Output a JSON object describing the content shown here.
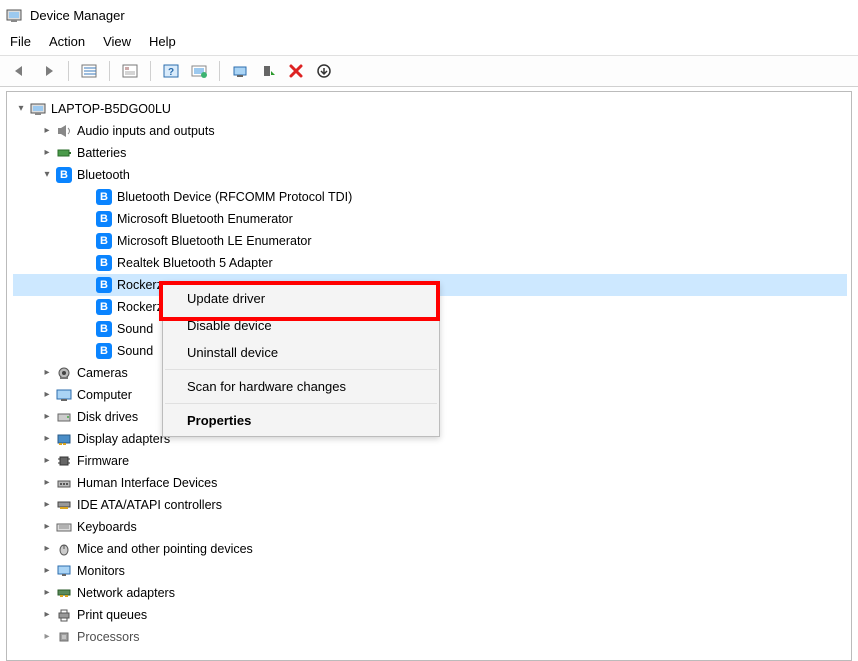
{
  "window": {
    "title": "Device Manager"
  },
  "menubar": {
    "items": [
      "File",
      "Action",
      "View",
      "Help"
    ]
  },
  "toolbar": {
    "buttons": [
      "back",
      "forward",
      "show-hidden",
      "help-topics",
      "help",
      "scan-hardware",
      "enable",
      "disable",
      "uninstall",
      "update-driver"
    ]
  },
  "tree": {
    "root": "LAPTOP-B5DGO0LU",
    "nodes": [
      {
        "label": "Audio inputs and outputs",
        "icon": "speaker",
        "expanded": false
      },
      {
        "label": "Batteries",
        "icon": "battery",
        "expanded": false
      },
      {
        "label": "Bluetooth",
        "icon": "bluetooth",
        "expanded": true,
        "children": [
          {
            "label": "Bluetooth Device (RFCOMM Protocol TDI)",
            "icon": "bluetooth"
          },
          {
            "label": "Microsoft Bluetooth Enumerator",
            "icon": "bluetooth"
          },
          {
            "label": "Microsoft Bluetooth LE Enumerator",
            "icon": "bluetooth"
          },
          {
            "label": "Realtek Bluetooth 5 Adapter",
            "icon": "bluetooth"
          },
          {
            "label": "Rockerz",
            "icon": "bluetooth",
            "selected": true,
            "clipped": true
          },
          {
            "label": "Rockerz",
            "icon": "bluetooth",
            "clipped": true
          },
          {
            "label": "Sound",
            "icon": "bluetooth",
            "clipped": true
          },
          {
            "label": "Sound",
            "icon": "bluetooth",
            "clipped": true
          }
        ]
      },
      {
        "label": "Cameras",
        "icon": "camera",
        "expanded": false
      },
      {
        "label": "Computer",
        "icon": "computer",
        "expanded": false
      },
      {
        "label": "Disk drives",
        "icon": "disk",
        "expanded": false
      },
      {
        "label": "Display adapters",
        "icon": "display",
        "expanded": false
      },
      {
        "label": "Firmware",
        "icon": "firmware",
        "expanded": false
      },
      {
        "label": "Human Interface Devices",
        "icon": "hid",
        "expanded": false
      },
      {
        "label": "IDE ATA/ATAPI controllers",
        "icon": "ide",
        "expanded": false
      },
      {
        "label": "Keyboards",
        "icon": "keyboard",
        "expanded": false
      },
      {
        "label": "Mice and other pointing devices",
        "icon": "mouse",
        "expanded": false
      },
      {
        "label": "Monitors",
        "icon": "monitor",
        "expanded": false
      },
      {
        "label": "Network adapters",
        "icon": "network",
        "expanded": false
      },
      {
        "label": "Print queues",
        "icon": "printer",
        "expanded": false
      },
      {
        "label": "Processors",
        "icon": "processor",
        "expanded": false
      }
    ]
  },
  "context_menu": {
    "items": [
      {
        "label": "Update driver",
        "highlighted": true
      },
      {
        "label": "Disable device"
      },
      {
        "label": "Uninstall device"
      },
      {
        "sep": true
      },
      {
        "label": "Scan for hardware changes"
      },
      {
        "sep": true
      },
      {
        "label": "Properties",
        "bold": true
      }
    ]
  }
}
